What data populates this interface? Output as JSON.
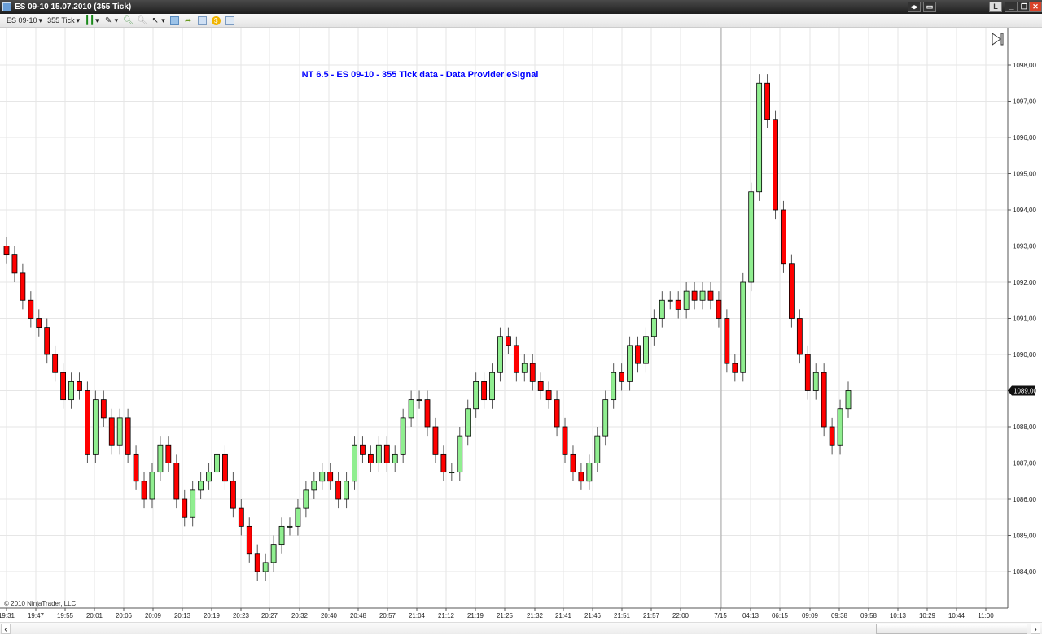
{
  "window": {
    "title": "ES 09-10  15.07.2010 (355 Tick)",
    "layout_button": "L"
  },
  "toolbar": {
    "instrument": "ES 09-10",
    "interval": "355 Tick",
    "icons": [
      "candlestick-icon",
      "pencil-draw-icon",
      "zoom-in-icon",
      "zoom-out-icon",
      "cursor-icon",
      "properties-icon",
      "instrument-link-icon",
      "strategy-icon",
      "orders-icon",
      "data-box-icon"
    ]
  },
  "colors": {
    "up": "#90ee90",
    "down": "#ff0000",
    "title_text": "#0000ff",
    "grid": "#e6e6e6"
  },
  "chart_data": {
    "type": "candlestick",
    "title": "NT 6.5 - ES 09-10 - 355 Tick data - Data Provider eSignal",
    "copyright": "© 2010 NinjaTrader, LLC",
    "ylim": [
      1083.5,
      1098.6
    ],
    "y_ticks": [
      "1084,00",
      "1085,00",
      "1086,00",
      "1087,00",
      "1088,00",
      "1089,00",
      "1090,00",
      "1091,00",
      "1092,00",
      "1093,00",
      "1094,00",
      "1095,00",
      "1096,00",
      "1097,00",
      "1098,00"
    ],
    "x_ticks": [
      "19:31",
      "19:47",
      "19:55",
      "20:01",
      "20:06",
      "20:09",
      "20:13",
      "20:19",
      "20:23",
      "20:27",
      "20:32",
      "20:40",
      "20:48",
      "20:57",
      "21:04",
      "21:12",
      "21:19",
      "21:25",
      "21:32",
      "21:41",
      "21:46",
      "21:51",
      "21:57",
      "22:00",
      "7/15",
      "04:13",
      "06:15",
      "09:09",
      "09:38",
      "09:58",
      "10:13",
      "10:29",
      "10:44",
      "11:00"
    ],
    "last_price": "1089,00",
    "grid": true,
    "closes": [
      1092.75,
      1092.25,
      1091.5,
      1091,
      1090.75,
      1090,
      1089.5,
      1088.75,
      1089.25,
      1089,
      1087.25,
      1088.75,
      1088.25,
      1087.5,
      1088.25,
      1087.25,
      1086.5,
      1086,
      1086.75,
      1087.5,
      1087,
      1086,
      1085.5,
      1086.25,
      1086.5,
      1086.75,
      1087.25,
      1086.5,
      1085.75,
      1085.25,
      1084.5,
      1084,
      1084.25,
      1084.75,
      1085.25,
      1085.25,
      1085.75,
      1086.25,
      1086.5,
      1086.75,
      1086.5,
      1086,
      1086.5,
      1087.5,
      1087.25,
      1087,
      1087.5,
      1087,
      1087.25,
      1088.25,
      1088.75,
      1088.75,
      1088,
      1087.25,
      1086.75,
      1086.75,
      1087.75,
      1088.5,
      1089.25,
      1088.75,
      1089.5,
      1090.5,
      1090.25,
      1089.5,
      1089.75,
      1089.25,
      1089,
      1088.75,
      1088,
      1087.25,
      1086.75,
      1086.5,
      1087,
      1087.75,
      1088.75,
      1089.5,
      1089.25,
      1090.25,
      1089.75,
      1090.5,
      1091,
      1091.5,
      1091.5,
      1091.25,
      1091.75,
      1091.5,
      1091.75,
      1091.5,
      1091,
      1089.75,
      1089.5,
      1092,
      1094.5,
      1097.5,
      1096.5,
      1094,
      1092.5,
      1091,
      1090,
      1089,
      1089.5,
      1088,
      1087.5,
      1088.5,
      1089
    ]
  }
}
